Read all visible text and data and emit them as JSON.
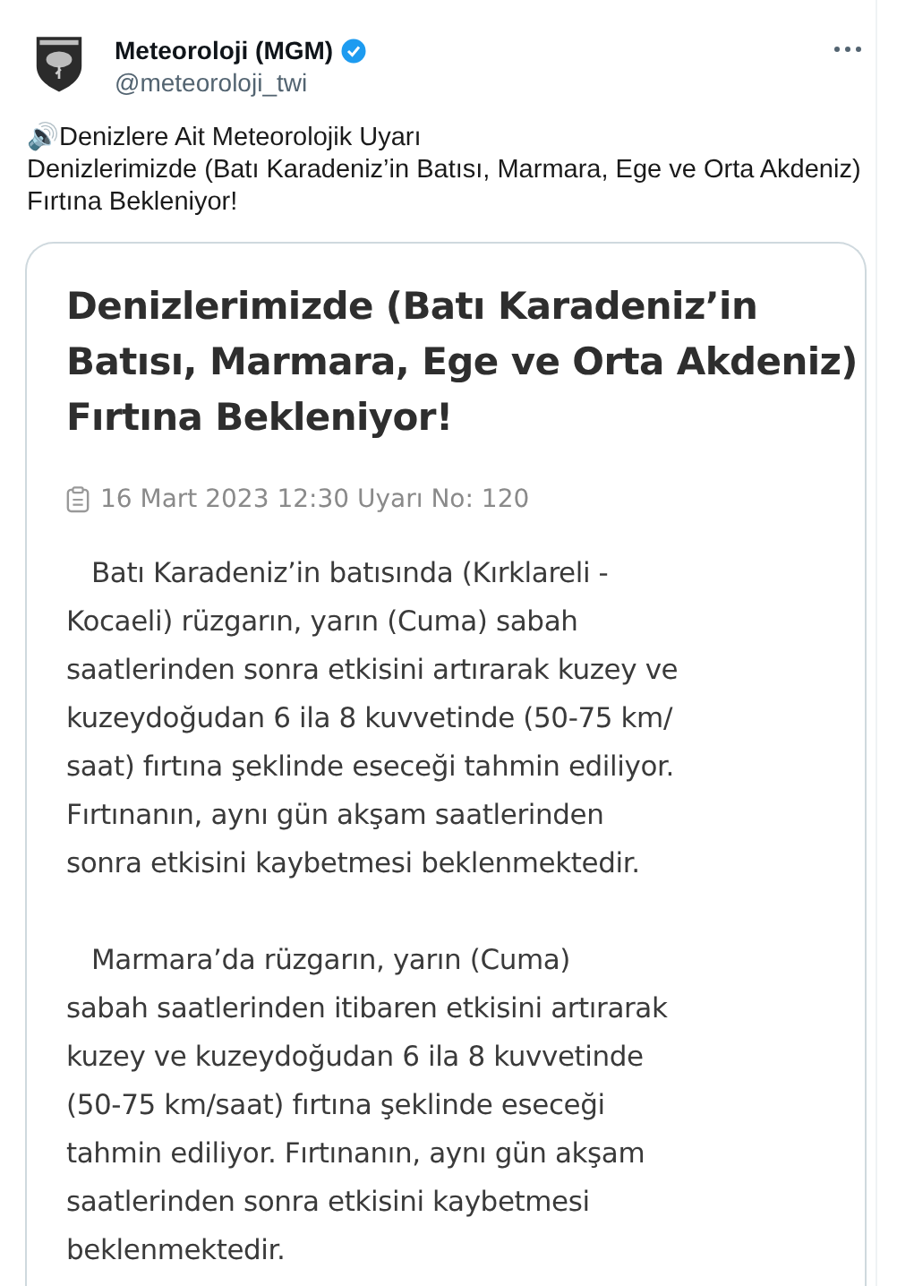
{
  "tweet": {
    "author": {
      "name": "Meteoroloji (MGM)",
      "verified": true,
      "handle": "@meteoroloji_twi"
    },
    "text_lines": [
      "🔊Denizlere Ait Meteorolojik Uyarı",
      "Denizlerimizde (Batı Karadeniz’in Batısı, Marmara, Ege ve Orta Akdeniz)",
      "Fırtına Bekleniyor!"
    ],
    "attachment": {
      "title_lines": [
        "Denizlerimizde (Batı Karadeniz’in",
        "Batısı, Marmara, Ege ve Orta Akdeniz)",
        "Fırtına Bekleniyor!"
      ],
      "meta": "16 Mart 2023 12:30 Uyarı No: 120",
      "paragraphs": [
        [
          "Batı Karadeniz’in batısında (Kırklareli -",
          "Kocaeli) rüzgarın, yarın (Cuma)  sabah",
          "saatlerinden sonra etkisini artırarak kuzey ve",
          "kuzeydoğudan 6 ila 8 kuvvetinde (50-75 km/",
          "saat) fırtına şeklinde eseceği tahmin ediliyor.",
          "Fırtınanın, aynı gün akşam saatlerinden",
          "sonra etkisini kaybetmesi beklenmektedir."
        ],
        [
          "Marmara’da rüzgarın, yarın (Cuma)",
          "sabah saatlerinden itibaren etkisini artırarak",
          "kuzey ve kuzeydoğudan 6 ila 8 kuvvetinde",
          "(50-75 km/saat) fırtına şeklinde eseceği",
          "tahmin ediliyor. Fırtınanın, aynı gün akşam",
          "saatlerinden sonra etkisini kaybetmesi",
          "beklenmektedir."
        ]
      ]
    }
  }
}
